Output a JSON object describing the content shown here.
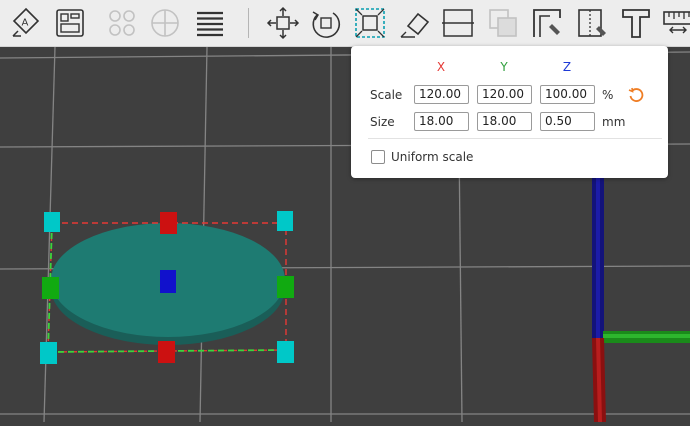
{
  "toolbar": {
    "tools": [
      {
        "name": "auto-orient-tool",
        "icon": "auto-orient-icon"
      },
      {
        "name": "arrange-tool",
        "icon": "arrange-icon"
      },
      {
        "name": "split-objects-tool",
        "icon": "split-objects-icon"
      },
      {
        "name": "split-parts-tool",
        "icon": "split-parts-icon"
      },
      {
        "name": "layers-tool",
        "icon": "layers-icon"
      },
      {
        "name": "move-tool",
        "icon": "move-icon"
      },
      {
        "name": "rotate-tool",
        "icon": "rotate-icon"
      },
      {
        "name": "scale-tool",
        "icon": "scale-icon"
      },
      {
        "name": "place-on-face-tool",
        "icon": "place-on-face-icon"
      },
      {
        "name": "cut-tool",
        "icon": "cut-icon"
      },
      {
        "name": "boolean-tool",
        "icon": "boolean-icon"
      },
      {
        "name": "support-paint-tool",
        "icon": "support-paint-icon"
      },
      {
        "name": "seam-paint-tool",
        "icon": "seam-paint-icon"
      },
      {
        "name": "text-tool",
        "icon": "text-icon"
      },
      {
        "name": "measure-tool",
        "icon": "measure-icon"
      }
    ],
    "active": "scale-tool"
  },
  "scale_panel": {
    "axes": {
      "x": "X",
      "y": "Y",
      "z": "Z"
    },
    "axis_colors": {
      "x": "#e53935",
      "y": "#2e9e3b",
      "z": "#1e3ad6"
    },
    "scale_label": "Scale",
    "size_label": "Size",
    "scale": {
      "x": "120.00",
      "y": "120.00",
      "z": "100.00"
    },
    "size": {
      "x": "18.00",
      "y": "18.00",
      "z": "0.50"
    },
    "scale_unit": "%",
    "size_unit": "mm",
    "uniform_scale_label": "Uniform scale",
    "uniform_scale_checked": false,
    "reset_icon": "reset-icon"
  },
  "colors": {
    "object": "#1e7b72",
    "accent": "#00a8a8",
    "reset": "#ef7d24"
  }
}
